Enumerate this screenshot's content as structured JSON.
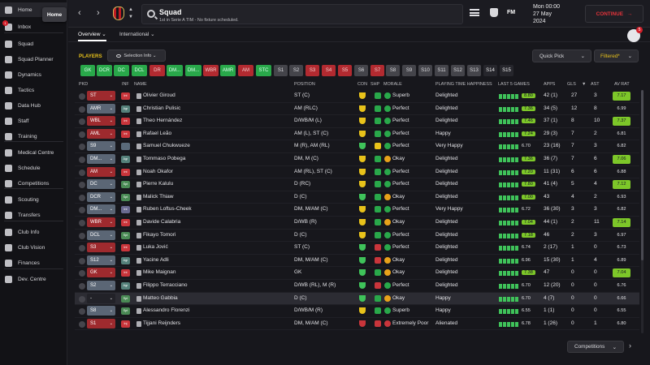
{
  "sidebar": {
    "tooltip": "Home",
    "inbox_badge": "1",
    "items": [
      {
        "label": "Home",
        "icon": "home-icon"
      },
      {
        "label": "Inbox",
        "icon": "inbox-icon"
      },
      {
        "label": "Squad",
        "icon": "squad-icon"
      },
      {
        "label": "Squad Planner",
        "icon": "squad-planner-icon"
      },
      {
        "label": "Dynamics",
        "icon": "dynamics-icon"
      },
      {
        "label": "Tactics",
        "icon": "tactics-icon"
      },
      {
        "label": "Data Hub",
        "icon": "data-hub-icon"
      },
      {
        "label": "Staff",
        "icon": "staff-icon"
      },
      {
        "label": "Training",
        "icon": "training-icon"
      },
      {
        "label": "Medical Centre",
        "icon": "medical-icon"
      },
      {
        "label": "Schedule",
        "icon": "schedule-icon"
      },
      {
        "label": "Competitions",
        "icon": "competitions-icon"
      },
      {
        "label": "Scouting",
        "icon": "scouting-icon"
      },
      {
        "label": "Transfers",
        "icon": "transfers-icon"
      },
      {
        "label": "Club Info",
        "icon": "club-info-icon"
      },
      {
        "label": "Club Vision",
        "icon": "club-vision-icon"
      },
      {
        "label": "Finances",
        "icon": "finances-icon"
      },
      {
        "label": "Dev. Centre",
        "icon": "dev-centre-icon"
      }
    ]
  },
  "header": {
    "title": "Squad",
    "subtitle": "1st in Serie A TIM - No fixture scheduled.",
    "fm_logo": "FM",
    "date_line1": "Mon 00:00",
    "date_line2": "27 May",
    "date_line3": "2024",
    "continue_label": "CONTINUE",
    "continue_arrow": "→",
    "back_arrow": "‹",
    "forward_arrow": "›"
  },
  "subnav": {
    "overview": "Overview ⌄",
    "international": "International ⌄",
    "avatar_badge": "5"
  },
  "toolbar": {
    "players_label": "PLAYERS",
    "selection_info": "Selection Info ⌄",
    "quick_pick": "Quick Pick",
    "quick_pick_chevron": "⌄",
    "filtered": "Filtered*",
    "filtered_chevron": "⌄"
  },
  "position_filters": [
    {
      "label": "GK",
      "color": "green"
    },
    {
      "label": "DCR",
      "color": "green"
    },
    {
      "label": "DC",
      "color": "green"
    },
    {
      "label": "DCL",
      "color": "green"
    },
    {
      "label": "DR",
      "color": "red"
    },
    {
      "label": "DM...",
      "color": "green"
    },
    {
      "label": "DM...",
      "color": "green"
    },
    {
      "label": "WBR",
      "color": "red"
    },
    {
      "label": "AMR",
      "color": "green"
    },
    {
      "label": "AM",
      "color": "red"
    },
    {
      "label": "STC",
      "color": "green"
    },
    {
      "label": "S1",
      "color": "grey"
    },
    {
      "label": "S2",
      "color": "grey"
    },
    {
      "label": "S3",
      "color": "red"
    },
    {
      "label": "S4",
      "color": "red"
    },
    {
      "label": "S5",
      "color": "red"
    },
    {
      "label": "S6",
      "color": "grey"
    },
    {
      "label": "S7",
      "color": "red"
    },
    {
      "label": "S8",
      "color": "grey"
    },
    {
      "label": "S9",
      "color": "grey"
    },
    {
      "label": "S10",
      "color": "grey"
    },
    {
      "label": "S11",
      "color": "grey"
    },
    {
      "label": "S12",
      "color": "grey"
    },
    {
      "label": "S13",
      "color": "grey"
    },
    {
      "label": "S14",
      "color": "dark"
    },
    {
      "label": "S15",
      "color": "dark"
    }
  ],
  "columns": {
    "pkd": "PKD",
    "inf": "INF",
    "name": "NAME",
    "position": "POSITION",
    "con": "CON",
    "shp": "SHP",
    "morale": "MORALE",
    "happiness": "PLAYING TIME HAPPINESS",
    "last5": "LAST 5 GAMES",
    "apps": "APPS",
    "gls": "GLS",
    "ast": "AST",
    "avrat": "AV RAT"
  },
  "players": [
    {
      "role": "ST",
      "role_color": "red",
      "inf": "Int",
      "inf_color": "#c9353b",
      "name": "Olivier Giroud",
      "position": "ST (C)",
      "con_color": "#e8c21a",
      "shp_color": "#29a84a",
      "morale": "Superb",
      "morale_color": "#29a84a",
      "happiness": "Delighted",
      "form": "8.80",
      "apps": "42 (1)",
      "gls": "27",
      "ast": "3",
      "avrat": "7.17",
      "avrat_color": "green"
    },
    {
      "role": "AMR",
      "role_color": "blue",
      "inf": "Agr",
      "inf_color": "#55807a",
      "name": "Christian Pulisic",
      "position": "AM (RLC)",
      "con_color": "#e8c21a",
      "shp_color": "#29a84a",
      "morale": "Perfect",
      "morale_color": "#29a84a",
      "happiness": "Delighted",
      "form": "7.36",
      "apps": "34 (5)",
      "gls": "12",
      "ast": "8",
      "avrat": "6.99",
      "avrat_color": "none"
    },
    {
      "role": "WBL",
      "role_color": "red",
      "inf": "Int",
      "inf_color": "#c9353b",
      "name": "Theo Hernández",
      "position": "D/WB/M (L)",
      "con_color": "#e8c21a",
      "shp_color": "#29a84a",
      "morale": "Perfect",
      "morale_color": "#29a84a",
      "happiness": "Delighted",
      "form": "7.46",
      "apps": "37 (1)",
      "gls": "8",
      "ast": "10",
      "avrat": "7.37",
      "avrat_color": "green"
    },
    {
      "role": "AML",
      "role_color": "red",
      "inf": "Int",
      "inf_color": "#c9353b",
      "name": "Rafael Leão",
      "position": "AM (L), ST (C)",
      "con_color": "#e8c21a",
      "shp_color": "#29a84a",
      "morale": "Perfect",
      "morale_color": "#29a84a",
      "happiness": "Happy",
      "form": "7.24",
      "apps": "29 (3)",
      "gls": "7",
      "ast": "2",
      "avrat": "6.81",
      "avrat_color": "none"
    },
    {
      "role": "S9",
      "role_color": "blue",
      "inf": "",
      "inf_color": "#5a6a7a",
      "name": "Samuel Chukwueze",
      "position": "M (R), AM (RL)",
      "con_color": "#3fc35a",
      "shp_color": "#e8c21a",
      "morale": "Perfect",
      "morale_color": "#29a84a",
      "happiness": "Very Happy",
      "form": "6.70",
      "apps": "23 (16)",
      "gls": "7",
      "ast": "3",
      "avrat": "6.82",
      "avrat_color": "none"
    },
    {
      "role": "DM...",
      "role_color": "blue",
      "inf": "Agr",
      "inf_color": "#55807a",
      "name": "Tommaso Pobega",
      "position": "DM, M (C)",
      "con_color": "#e8c21a",
      "shp_color": "#29a84a",
      "morale": "Okay",
      "morale_color": "#e8a21a",
      "happiness": "Delighted",
      "form": "7.36",
      "apps": "36 (7)",
      "gls": "7",
      "ast": "6",
      "avrat": "7.06",
      "avrat_color": "green"
    },
    {
      "role": "AM",
      "role_color": "red",
      "inf": "Int",
      "inf_color": "#c9353b",
      "name": "Noah Okafor",
      "position": "AM (RL), ST (C)",
      "con_color": "#e8c21a",
      "shp_color": "#29a84a",
      "morale": "Perfect",
      "morale_color": "#29a84a",
      "happiness": "Delighted",
      "form": "7.20",
      "apps": "11 (31)",
      "gls": "6",
      "ast": "6",
      "avrat": "6.88",
      "avrat_color": "none"
    },
    {
      "role": "DC",
      "role_color": "blue",
      "inf": "Spt",
      "inf_color": "#4a8a55",
      "name": "Pierre Kalulu",
      "position": "D (RC)",
      "con_color": "#e8c21a",
      "shp_color": "#29a84a",
      "morale": "Perfect",
      "morale_color": "#29a84a",
      "happiness": "Delighted",
      "form": "7.80",
      "apps": "41 (4)",
      "gls": "5",
      "ast": "4",
      "avrat": "7.12",
      "avrat_color": "green"
    },
    {
      "role": "DCR",
      "role_color": "blue",
      "inf": "Spt",
      "inf_color": "#4a8a55",
      "name": "Malick Thiaw",
      "position": "D (C)",
      "con_color": "#3fc35a",
      "shp_color": "#29a84a",
      "morale": "Okay",
      "morale_color": "#e8a21a",
      "happiness": "Delighted",
      "form": "7.00",
      "apps": "43",
      "gls": "4",
      "ast": "2",
      "avrat": "6.93",
      "avrat_color": "none"
    },
    {
      "role": "DM...",
      "role_color": "blue",
      "inf": "Int",
      "inf_color": "#6a6a90",
      "name": "Ruben Loftus-Cheek",
      "position": "DM, M/AM (C)",
      "con_color": "#e8c21a",
      "shp_color": "#29a84a",
      "morale": "Perfect",
      "morale_color": "#29a84a",
      "happiness": "Very Happy",
      "form": "6.72",
      "apps": "36 (30)",
      "gls": "3",
      "ast": "3",
      "avrat": "6.82",
      "avrat_color": "none"
    },
    {
      "role": "WBR",
      "role_color": "red",
      "inf": "Int",
      "inf_color": "#c9353b",
      "name": "Davide Calabria",
      "position": "D/WB (R)",
      "con_color": "#e8c21a",
      "shp_color": "#29a84a",
      "morale": "Okay",
      "morale_color": "#e8a21a",
      "happiness": "Delighted",
      "form": "7.04",
      "apps": "44 (1)",
      "gls": "2",
      "ast": "11",
      "avrat": "7.14",
      "avrat_color": "green"
    },
    {
      "role": "DCL",
      "role_color": "blue",
      "inf": "Spt",
      "inf_color": "#4a8a55",
      "name": "Fikayo Tomori",
      "position": "D (C)",
      "con_color": "#e8c21a",
      "shp_color": "#29a84a",
      "morale": "Perfect",
      "morale_color": "#29a84a",
      "happiness": "Delighted",
      "form": "7.18",
      "apps": "46",
      "gls": "2",
      "ast": "3",
      "avrat": "6.97",
      "avrat_color": "none"
    },
    {
      "role": "S3",
      "role_color": "red",
      "inf": "Int",
      "inf_color": "#c9353b",
      "name": "Luka Jović",
      "position": "ST (C)",
      "con_color": "#3fc35a",
      "shp_color": "#c9353b",
      "morale": "Perfect",
      "morale_color": "#29a84a",
      "happiness": "Delighted",
      "form": "6.74",
      "apps": "2 (17)",
      "gls": "1",
      "ast": "0",
      "avrat": "6.73",
      "avrat_color": "none"
    },
    {
      "role": "S12",
      "role_color": "blue",
      "inf": "Agr",
      "inf_color": "#55807a",
      "name": "Yacine Adli",
      "position": "DM, M/AM (C)",
      "con_color": "#3fc35a",
      "shp_color": "#c9353b",
      "morale": "Okay",
      "morale_color": "#e8a21a",
      "happiness": "Delighted",
      "form": "6.96",
      "apps": "15 (30)",
      "gls": "1",
      "ast": "4",
      "avrat": "6.89",
      "avrat_color": "none"
    },
    {
      "role": "GK",
      "role_color": "red",
      "inf": "Int",
      "inf_color": "#c9353b",
      "name": "Mike Maignan",
      "position": "GK",
      "con_color": "#3fc35a",
      "shp_color": "#29a84a",
      "morale": "Okay",
      "morale_color": "#e8a21a",
      "happiness": "Delighted",
      "form": "7.38",
      "apps": "47",
      "gls": "0",
      "ast": "0",
      "avrat": "7.04",
      "avrat_color": "green"
    },
    {
      "role": "S2",
      "role_color": "blue",
      "inf": "Agr",
      "inf_color": "#55807a",
      "name": "Filippo Terracciano",
      "position": "D/WB (RL), M (R)",
      "con_color": "#3fc35a",
      "shp_color": "#c9353b",
      "morale": "Perfect",
      "morale_color": "#29a84a",
      "happiness": "Delighted",
      "form": "6.70",
      "apps": "12 (20)",
      "gls": "0",
      "ast": "0",
      "avrat": "6.76",
      "avrat_color": "none"
    },
    {
      "role": "-",
      "role_color": "dark",
      "inf": "Spt",
      "inf_color": "#4a8a55",
      "name": "Matteo Gabbia",
      "position": "D (C)",
      "con_color": "#3fc35a",
      "shp_color": "#29a84a",
      "morale": "Okay",
      "morale_color": "#e8a21a",
      "happiness": "Happy",
      "form": "6.70",
      "apps": "4 (7)",
      "gls": "0",
      "ast": "0",
      "avrat": "6.66",
      "avrat_color": "none"
    },
    {
      "role": "S8",
      "role_color": "blue",
      "inf": "Spt",
      "inf_color": "#4a8a55",
      "name": "Alessandro Florenzi",
      "position": "D/WB/M (R)",
      "con_color": "#e8c21a",
      "shp_color": "#29a84a",
      "morale": "Superb",
      "morale_color": "#29a84a",
      "happiness": "Happy",
      "form": "6.55",
      "apps": "1 (1)",
      "gls": "0",
      "ast": "0",
      "avrat": "6.55",
      "avrat_color": "none"
    },
    {
      "role": "S1",
      "role_color": "red",
      "inf": "Inj",
      "inf_color": "#c9353b",
      "name": "Tijjani Reijnders",
      "position": "DM, M/AM (C)",
      "con_color": "#c9353b",
      "shp_color": "#c9353b",
      "morale": "Extremely Poor",
      "morale_color": "#c9353b",
      "happiness": "Alienated",
      "form": "6.78",
      "apps": "1 (26)",
      "gls": "0",
      "ast": "1",
      "avrat": "6.80",
      "avrat_color": "none"
    }
  ],
  "footer": {
    "competitions": "Competitions",
    "competitions_chevron": "⌄",
    "next_arrow": "›"
  }
}
